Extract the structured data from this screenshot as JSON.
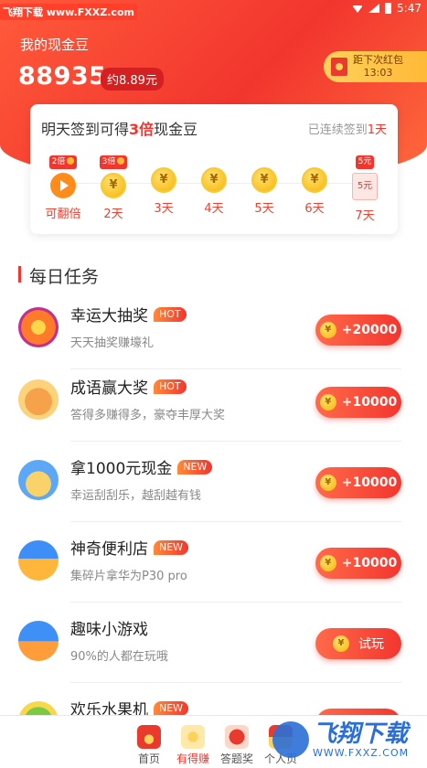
{
  "watermark_top": "飞翔下载 www.FXXZ.com",
  "status": {
    "time": "5:47"
  },
  "header": {
    "balance_label": "我的现金豆",
    "balance_value": "88935",
    "balance_yuan": "约8.89元",
    "redpack_label": "距下次红包",
    "redpack_time": "13:03"
  },
  "sign_card": {
    "title_pre": "明天签到可得",
    "title_multiplier": "3倍",
    "title_post": "现金豆",
    "streak_pre": "已连续签到",
    "streak_days": "1天",
    "days": [
      {
        "tag": "2倍",
        "label": "可翻倍",
        "type": "play"
      },
      {
        "tag": "3倍",
        "label": "2天",
        "type": "coin"
      },
      {
        "tag": "",
        "label": "3天",
        "type": "coin"
      },
      {
        "tag": "",
        "label": "4天",
        "type": "coin"
      },
      {
        "tag": "",
        "label": "5天",
        "type": "coin"
      },
      {
        "tag": "",
        "label": "6天",
        "type": "coin"
      },
      {
        "tag": "5元",
        "label": "7天",
        "type": "redbox",
        "box_text": "5元"
      }
    ],
    "coin_symbol": "¥"
  },
  "tasks_section": {
    "title": "每日任务"
  },
  "tasks": [
    {
      "name": "幸运大抽奖",
      "badge": "HOT",
      "desc": "天天抽奖赚壕礼",
      "reward": "+20000",
      "icon": "wheel-icon"
    },
    {
      "name": "成语赢大奖",
      "badge": "HOT",
      "desc": "答得多赚得多，豪夺丰厚大奖",
      "reward": "+10000",
      "icon": "idiom-icon"
    },
    {
      "name": "拿1000元现金",
      "badge": "NEW",
      "desc": "幸运刮刮乐，越刮越有钱",
      "reward": "+10000",
      "icon": "cash-card-icon"
    },
    {
      "name": "神奇便利店",
      "badge": "NEW",
      "desc": "集碎片拿华为P30 pro",
      "reward": "+10000",
      "icon": "shop-icon"
    },
    {
      "name": "趣味小游戏",
      "badge": "",
      "desc": "90%的人都在玩哦",
      "reward": "试玩",
      "icon": "game-icon"
    },
    {
      "name": "欢乐水果机",
      "badge": "NEW",
      "desc": "",
      "reward": "",
      "icon": "fruit-icon"
    }
  ],
  "tabbar": {
    "home": "首页",
    "earn": "有得赚",
    "quiz": "答题奖",
    "me": "个人页"
  },
  "watermark_bottom": {
    "main": "飞翔下载",
    "url": "WWW.FXXZ.COM"
  }
}
